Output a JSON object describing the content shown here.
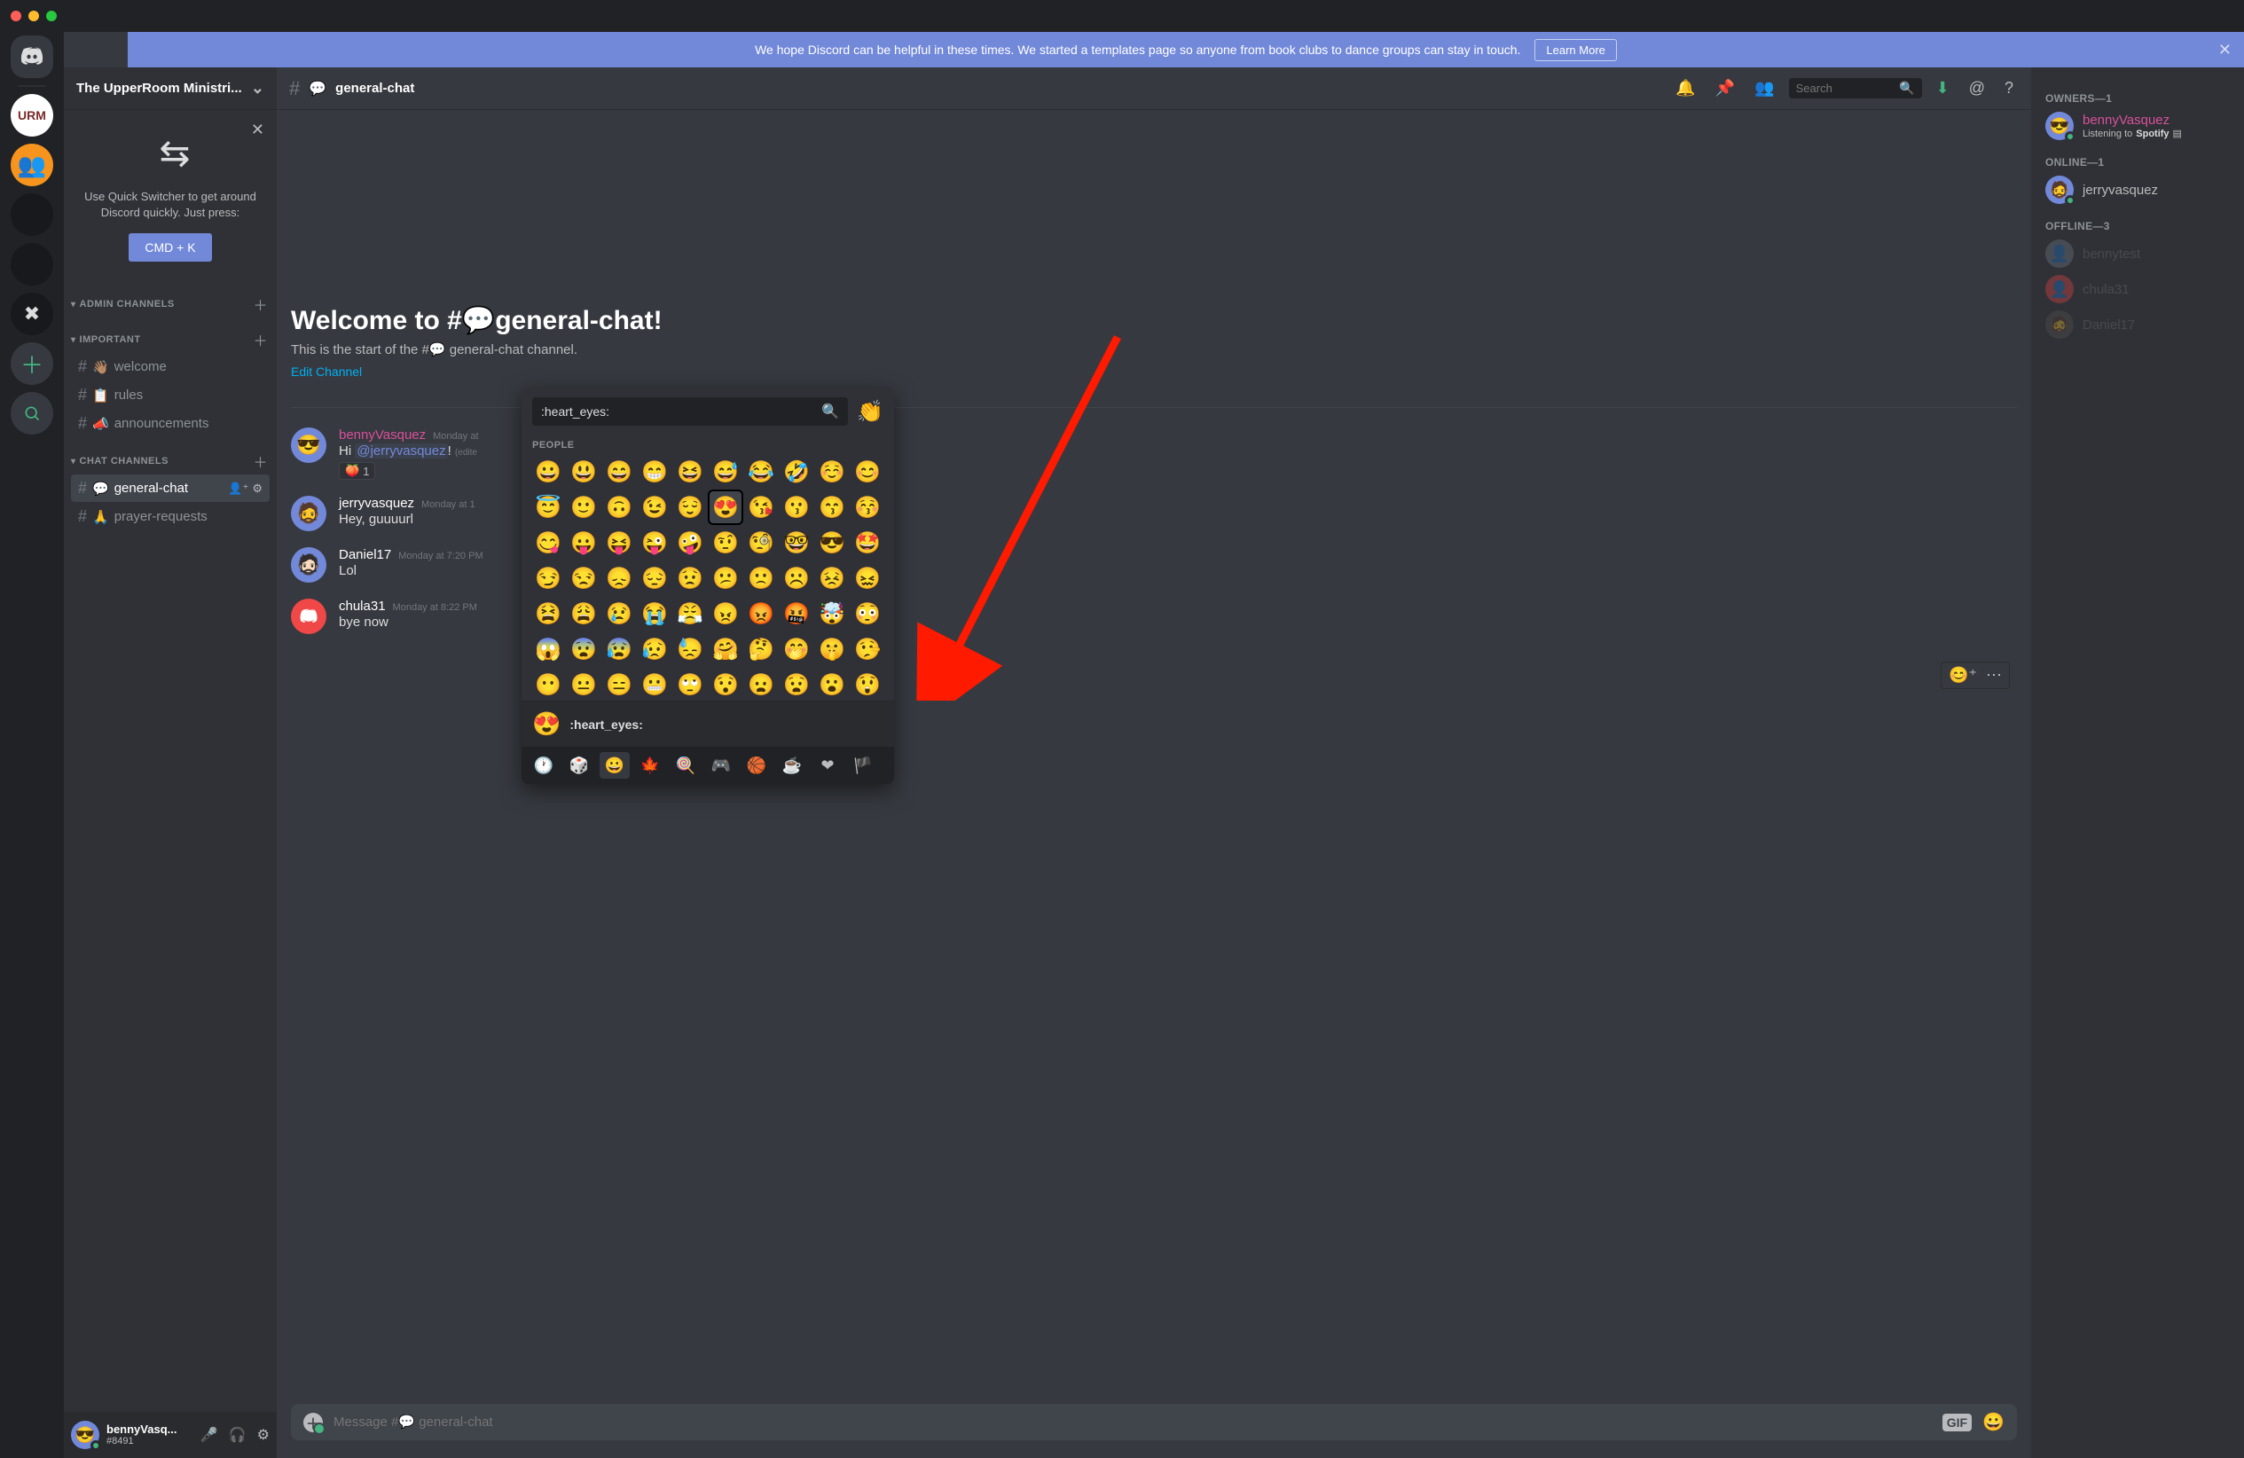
{
  "banner": {
    "text": "We hope Discord can be helpful in these times. We started a templates page so anyone from book clubs to dance groups can stay in touch.",
    "button": "Learn More"
  },
  "server_name": "The UpperRoom Ministri...",
  "quick_switcher": {
    "text": "Use Quick Switcher to get around Discord quickly. Just press:",
    "button": "CMD + K"
  },
  "categories": [
    {
      "label": "ADMIN CHANNELS",
      "channels": []
    },
    {
      "label": "IMPORTANT",
      "channels": [
        {
          "emoji": "👋🏽",
          "name": "welcome"
        },
        {
          "emoji": "📋",
          "name": "rules"
        },
        {
          "emoji": "📣",
          "name": "announcements"
        }
      ]
    },
    {
      "label": "CHAT CHANNELS",
      "channels": [
        {
          "emoji": "💬",
          "name": "general-chat",
          "active": true
        },
        {
          "emoji": "🙏",
          "name": "prayer-requests"
        }
      ]
    }
  ],
  "self_user": {
    "name": "bennyVasq...",
    "discriminator": "#8491"
  },
  "channel_title": {
    "emoji": "💬",
    "name": "general-chat"
  },
  "search_placeholder": "Search",
  "welcome": {
    "heading_pre": "Welcome to #",
    "heading_name": "general-chat!",
    "subtitle": "This is the start of the #💬 general-chat channel.",
    "edit": "Edit Channel"
  },
  "messages": [
    {
      "user": "bennyVasquez",
      "user_class": "pink",
      "time": "Monday at",
      "text_pre": "Hi ",
      "mention": "@jerryvasquez",
      "text_post": "!",
      "edited": "(edite",
      "reaction_emoji": "🍑",
      "reaction_count": "1"
    },
    {
      "user": "jerryvasquez",
      "user_class": "default",
      "time": "Monday at 1",
      "text": "Hey, guuuurl"
    },
    {
      "user": "Daniel17",
      "user_class": "default",
      "time": "Monday at 7:20 PM",
      "text": "Lol"
    },
    {
      "user": "chula31",
      "user_class": "default",
      "time": "Monday at 8:22 PM",
      "text": "bye now",
      "avatar_red": true
    }
  ],
  "composer_placeholder": "Message #💬 general-chat",
  "gif_label": "GIF",
  "members": {
    "cat1": "OWNERS—1",
    "owner": {
      "name": "bennyVasquez",
      "activity_pre": "Listening to ",
      "activity_app": "Spotify"
    },
    "cat2": "ONLINE—1",
    "online": [
      {
        "name": "jerryvasquez"
      }
    ],
    "cat3": "OFFLINE—3",
    "offline": [
      {
        "name": "bennytest"
      },
      {
        "name": "chula31",
        "red": true
      },
      {
        "name": "Daniel17"
      }
    ]
  },
  "emoji_picker": {
    "search_value": ":heart_eyes:",
    "tone_emoji": "👏",
    "category_label": "PEOPLE",
    "preview_emoji": "😍",
    "preview_name": ":heart_eyes:",
    "grid": [
      [
        "😀",
        "😃",
        "😄",
        "😁",
        "😆",
        "😅",
        "😂",
        "🤣",
        "☺️",
        "😊"
      ],
      [
        "😇",
        "🙂",
        "🙃",
        "😉",
        "😌",
        "😍",
        "😘",
        "😗",
        "😙",
        "😚"
      ],
      [
        "😋",
        "😛",
        "😝",
        "😜",
        "🤪",
        "🤨",
        "🧐",
        "🤓",
        "😎",
        "🤩"
      ],
      [
        "😏",
        "😒",
        "😞",
        "😔",
        "😟",
        "😕",
        "🙁",
        "☹️",
        "😣",
        "😖"
      ],
      [
        "😫",
        "😩",
        "😢",
        "😭",
        "😤",
        "😠",
        "😡",
        "🤬",
        "🤯",
        "😳"
      ],
      [
        "😱",
        "😨",
        "😰",
        "😥",
        "😓",
        "🤗",
        "🤔",
        "🤭",
        "🤫",
        "🤥"
      ],
      [
        "😶",
        "😐",
        "😑",
        "😬",
        "🙄",
        "😯",
        "😦",
        "😧",
        "😮",
        "😲"
      ]
    ],
    "selected_row": 1,
    "selected_col": 5,
    "tabs": [
      "🕐",
      "🎲",
      "😀",
      "🍁",
      "🍭",
      "🎮",
      "🏀",
      "☕",
      "❤",
      "🏴"
    ]
  }
}
